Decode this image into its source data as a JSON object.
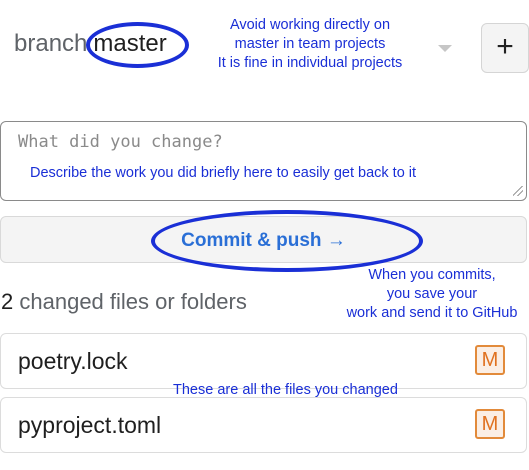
{
  "branch": {
    "label": "branch",
    "value": "master",
    "add_button": "+",
    "annotation": [
      "Avoid working directly on",
      "master in team projects",
      "It is fine in individual projects"
    ]
  },
  "message": {
    "placeholder": "What did you change?",
    "annotation": "Describe the work you did briefly here to easily get back to it"
  },
  "commit": {
    "label": "Commit & push →",
    "annotation": [
      "When you commits,",
      "you save your",
      "work and send it to GitHub"
    ]
  },
  "changes": {
    "count": "2",
    "label": "changed files or folders",
    "files": [
      {
        "name": "poetry.lock",
        "status": "M"
      },
      {
        "name": "pyproject.toml",
        "status": "M"
      }
    ],
    "annotation": "These are all the files you changed"
  },
  "colors": {
    "annotation": "#1a2fd6",
    "commit_text": "#2a6fd6",
    "badge": "#e0711f"
  }
}
